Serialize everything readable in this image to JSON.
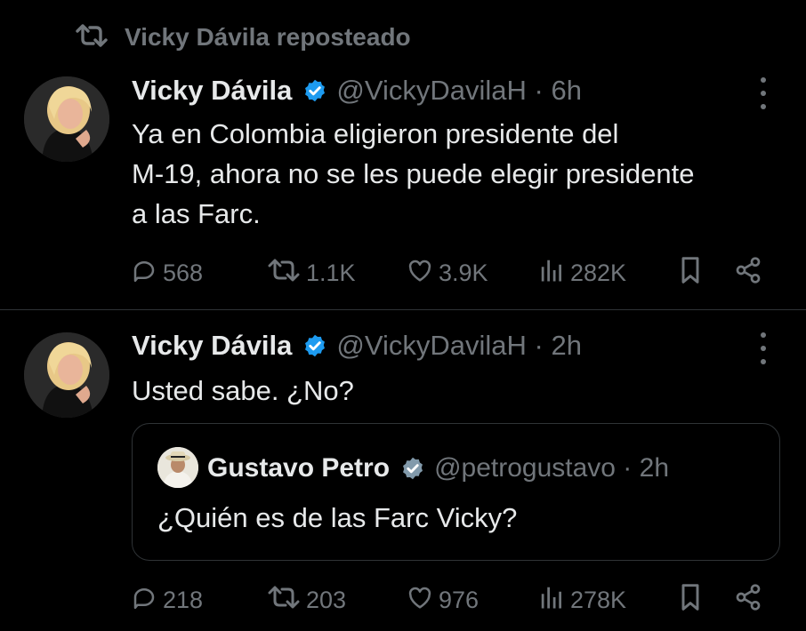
{
  "repost": {
    "label": "Vicky Dávila reposteado",
    "icon": "repost-icon"
  },
  "tweets": [
    {
      "name": "Vicky Dávila",
      "handle_time": "@VickyDavilaH · 6h",
      "text_lines": [
        "Ya en Colombia eligieron presidente del",
        "M-19, ahora no se les puede elegir presidente",
        "a las Farc."
      ],
      "stats": {
        "replies": "568",
        "reposts": "1.1K",
        "likes": "3.9K",
        "views": "282K"
      }
    },
    {
      "name": "Vicky Dávila",
      "handle_time": "@VickyDavilaH · 2h",
      "text_lines": [
        "Usted sabe. ¿No?"
      ],
      "quote": {
        "name": "Gustavo Petro",
        "handle_time": "@petrogustavo · 2h",
        "text": "¿Quién es de las Farc Vicky?"
      },
      "stats": {
        "replies": "218",
        "reposts": "203",
        "likes": "976",
        "views": "278K"
      }
    }
  ],
  "colors": {
    "background": "#000000",
    "text": "#e7e9ea",
    "muted": "#71767b",
    "verified_blue": "#1d9bf0",
    "verified_gray": "#829aab",
    "border": "#2f3336"
  }
}
